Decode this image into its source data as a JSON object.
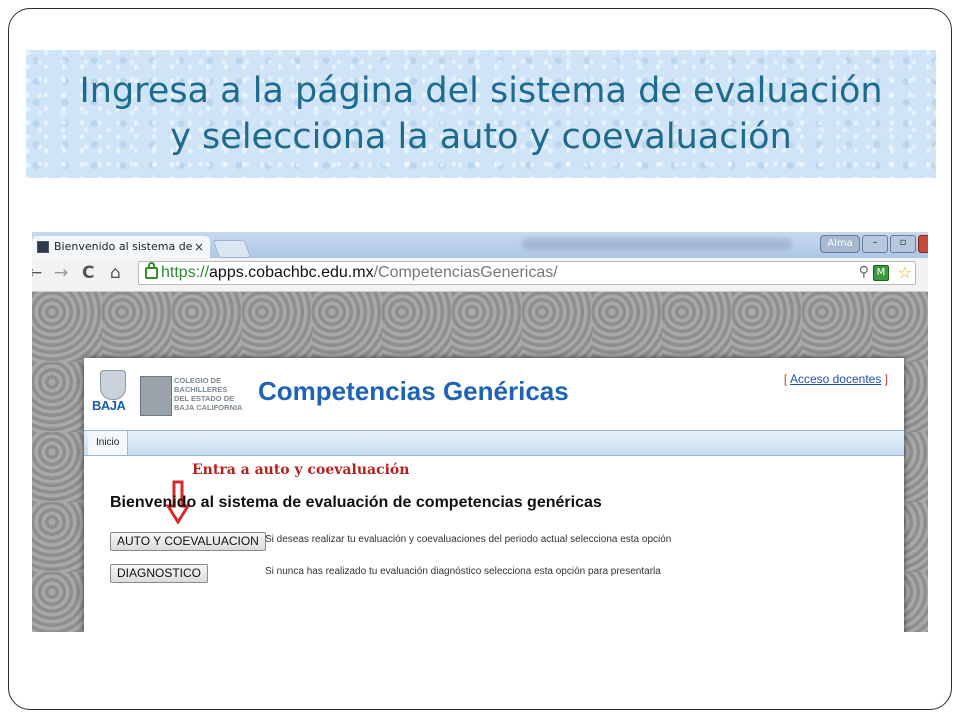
{
  "slide": {
    "title_line1": "Ingresa a la página del sistema de evaluación",
    "title_line2": "y selecciona  la auto y coevaluación"
  },
  "browser": {
    "tab_title": "Bienvenido al sistema de",
    "tab_close": "×",
    "profile": "Alma",
    "url_secure": "https://",
    "url_host": "apps.cobachbc.edu.mx",
    "url_path": "/CompetenciasGenericas/"
  },
  "site": {
    "logo_text": "BAJA",
    "org_name": "COLEGIO DE\nBACHILLERES\nDEL ESTADO DE\nBAJA CALIFORNIA",
    "title": "Competencias Genéricas",
    "docentes_link": "Acceso docentes",
    "menu": [
      "Inicio"
    ],
    "welcome": "Bienvenido al sistema de evaluación de competencias genéricas",
    "options": [
      {
        "button": "AUTO Y COEVALUACION",
        "description": "Si deseas realizar tu evaluación y coevaluaciones del periodo actual selecciona esta opción"
      },
      {
        "button": "DIAGNOSTICO",
        "description": "Si nunca has realizado tu evaluación diagnóstico selecciona esta opción para presentarla"
      }
    ]
  },
  "annotation": {
    "text": "Entra a auto y coevaluación",
    "color": "#b32020"
  },
  "colors": {
    "title_text": "#1e6b8c",
    "title_band": "#cfe4f6",
    "site_title": "#1f63b5"
  }
}
